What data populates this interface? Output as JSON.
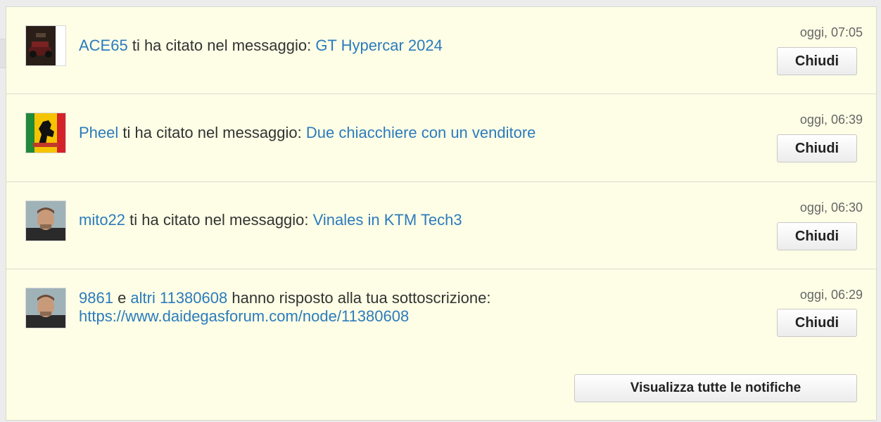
{
  "notifications": [
    {
      "user": "ACE65",
      "middle": " ti ha citato nel messaggio: ",
      "link": "GT Hypercar 2024",
      "time": "oggi, 07:05",
      "close_label": "Chiudi",
      "avatar_icon": "user-avatar-car"
    },
    {
      "user": "Pheel",
      "middle": " ti ha citato nel messaggio: ",
      "link": "Due chiacchiere con un venditore",
      "time": "oggi, 06:39",
      "close_label": "Chiudi",
      "avatar_icon": "user-avatar-prancing-horse"
    },
    {
      "user": "mito22",
      "middle": " ti ha citato nel messaggio: ",
      "link": "Vinales in KTM Tech3",
      "time": "oggi, 06:30",
      "close_label": "Chiudi",
      "avatar_icon": "user-avatar-person"
    },
    {
      "user": "9861",
      "conj": " e ",
      "others": "altri 11380608",
      "middle": " hanno risposto alla tua sottoscrizione:",
      "link": "https://www.daidegasforum.com/node/11380608",
      "time": "oggi, 06:29",
      "close_label": "Chiudi",
      "avatar_icon": "user-avatar-person"
    }
  ],
  "footer": {
    "view_all_label": "Visualizza tutte le notifiche"
  },
  "colors": {
    "panel_bg": "#fefee6",
    "link": "#2b7bbd"
  }
}
